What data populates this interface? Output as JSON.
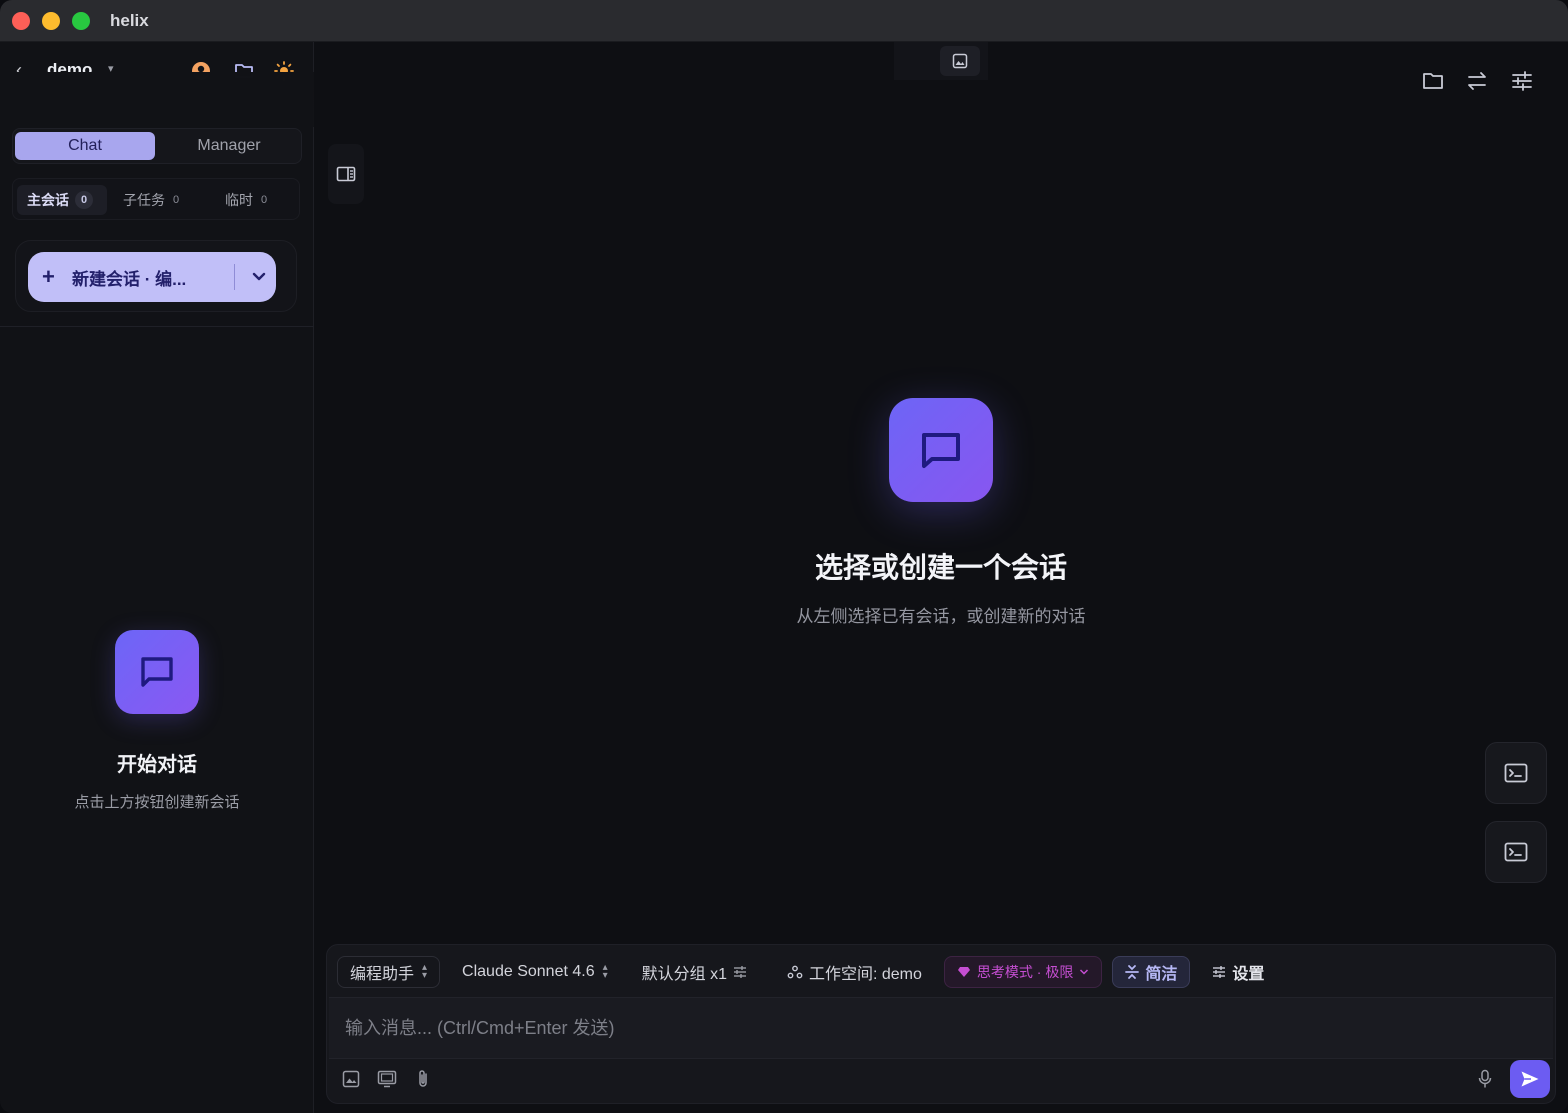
{
  "window": {
    "title": "helix"
  },
  "sidebar": {
    "project": {
      "name": "demo"
    },
    "modes": {
      "chat": "Chat",
      "manager": "Manager",
      "active": "Chat"
    },
    "subtabs": [
      {
        "label": "主会话",
        "count": "0"
      },
      {
        "label": "子任务",
        "count": "0"
      },
      {
        "label": "临时",
        "count": "0"
      }
    ],
    "new_session": {
      "label": "新建会话 · 编..."
    },
    "empty": {
      "title": "开始对话",
      "description": "点击上方按钮创建新会话"
    }
  },
  "main": {
    "empty": {
      "title": "选择或创建一个会话",
      "description": "从左侧选择已有会话，或创建新的对话"
    }
  },
  "composer": {
    "assistant": "编程助手",
    "model": "Claude Sonnet 4.6",
    "group": "默认分组 x1",
    "workspace": "工作空间: demo",
    "thinking": "思考模式 · 极限",
    "concise": "简洁",
    "settings": "设置",
    "placeholder": "输入消息... (Ctrl/Cmd+Enter 发送)"
  },
  "colors": {
    "accent": "#6c5cf2",
    "chat_tab": "#a8a6ee",
    "new_button": "#c1bff8",
    "thinking": "#c54ed2",
    "close": "#fe5f57",
    "minimize": "#febc2e",
    "maximize": "#28c840"
  },
  "icons": [
    "back-arrow-icon",
    "user-icon",
    "folder-icon",
    "sun-icon",
    "plus-icon",
    "chevron-down-icon",
    "chat-bubble-icon",
    "image-icon",
    "swap-icon",
    "sliders-icon",
    "sidebar-panel-icon",
    "terminal-icon",
    "people-icon",
    "gem-icon",
    "compress-icon",
    "screen-icon",
    "paperclip-icon",
    "mic-icon",
    "send-icon"
  ]
}
